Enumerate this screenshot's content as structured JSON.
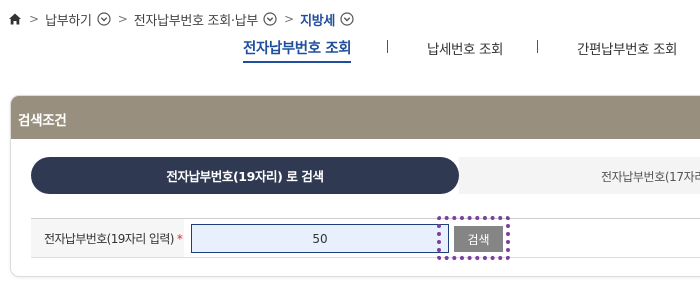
{
  "breadcrumb": {
    "items": [
      {
        "label": "납부하기"
      },
      {
        "label": "전자납부번호 조회·납부"
      },
      {
        "label": "지방세"
      }
    ]
  },
  "tabs": [
    {
      "label": "전자납부번호 조회",
      "active": true
    },
    {
      "label": "납세번호 조회",
      "active": false
    },
    {
      "label": "간편납부번호 조회",
      "active": false
    }
  ],
  "panel": {
    "title": "검색조건",
    "search_types": [
      {
        "label": "전자납부번호(19자리) 로 검색",
        "active": true
      },
      {
        "label": "전자납부번호(17자리",
        "active": false
      }
    ],
    "field": {
      "label": "전자납부번호(19자리 입력)",
      "required_mark": "*",
      "value": "50"
    },
    "search_button_label": "검색"
  },
  "colors": {
    "accent_blue": "#1f4e9c",
    "header_brown": "#998f7e",
    "pill_dark": "#2f3a52",
    "button_gray": "#858585",
    "highlight_purple": "#7b3f9e"
  },
  "icons": [
    "home-icon",
    "chevron-right-icon",
    "chevron-down-circle-icon"
  ]
}
